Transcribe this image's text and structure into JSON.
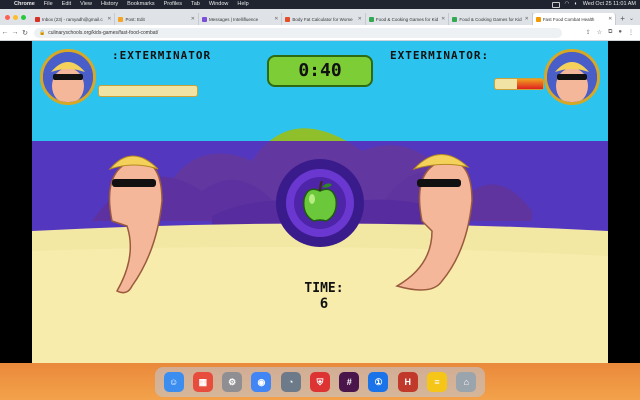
{
  "menubar": {
    "app_name": "Chrome",
    "menus": [
      "File",
      "Edit",
      "View",
      "History",
      "Bookmarks",
      "Profiles",
      "Tab",
      "Window",
      "Help"
    ],
    "clock": "Wed Oct 25  11:01 AM"
  },
  "tabs": [
    {
      "label": "Inbox (23) - ramyadh@gmail.c",
      "color": "#d93025"
    },
    {
      "label": "Post: Edit",
      "color": "#f4a623"
    },
    {
      "label": "Messages | Intellifluence",
      "color": "#7a4fd6"
    },
    {
      "label": "Body Fat Calculator for Wome",
      "color": "#e44d26"
    },
    {
      "label": "Food & Cooking Games for Kid",
      "color": "#34a853"
    },
    {
      "label": "Food & Cooking Games for Kid",
      "color": "#34a853"
    },
    {
      "label": "Fast Food Combat Health",
      "color": "#f29900",
      "active": true
    }
  ],
  "address_bar": {
    "url": "culinaryschools.org/kids-games/fast-food-combat/"
  },
  "game": {
    "player_name": ":EXTERMINATOR",
    "enemy_name": "EXTERMINATOR:",
    "timer": "0:40",
    "time_label": "TIME:",
    "time_value": "6",
    "player_health": 0.0,
    "enemy_health": 0.55,
    "center_item_icon": "green-apple-icon"
  },
  "dock_apps": [
    {
      "name": "finder-icon",
      "color": "#3b8ef0",
      "glyph": "☺"
    },
    {
      "name": "launchpad-icon",
      "color": "#e74c3c",
      "glyph": "▦"
    },
    {
      "name": "system-settings-icon",
      "color": "#8e8e93",
      "glyph": "⚙"
    },
    {
      "name": "chrome-icon",
      "color": "#4285f4",
      "glyph": "◉"
    },
    {
      "name": "intellifluence-icon",
      "color": "#6c7a89",
      "glyph": "◔"
    },
    {
      "name": "shield-app-icon",
      "color": "#d33",
      "glyph": "⛨"
    },
    {
      "name": "slack-icon",
      "color": "#4a154b",
      "glyph": "#"
    },
    {
      "name": "1password-icon",
      "color": "#1a73e8",
      "glyph": "①"
    },
    {
      "name": "hiq-icon",
      "color": "#c0392b",
      "glyph": "H"
    },
    {
      "name": "notes-icon",
      "color": "#f5c518",
      "glyph": "≡"
    },
    {
      "name": "trash-icon",
      "color": "#9aa4ad",
      "glyph": "🗑"
    }
  ]
}
